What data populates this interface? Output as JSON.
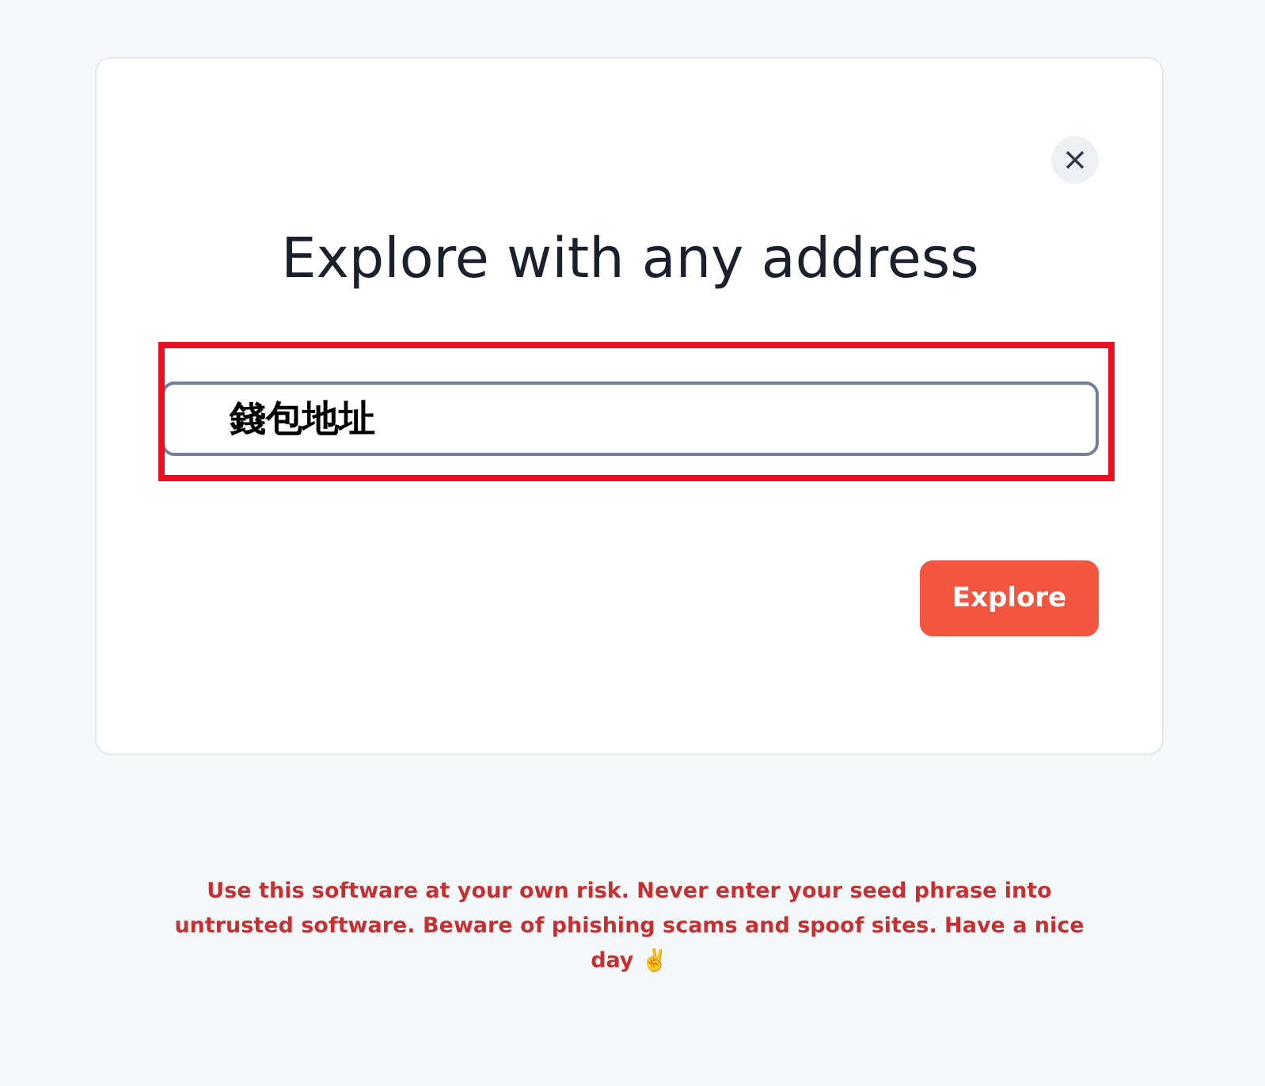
{
  "dialog": {
    "title": "Explore with any address",
    "address_field": {
      "value": "錢包地址"
    },
    "explore_button": "Explore"
  },
  "disclaimer": "Use this software at your own risk. Never enter your seed phrase into untrusted software. Beware of phishing scams and spoof sites. Have a nice day ✌️"
}
